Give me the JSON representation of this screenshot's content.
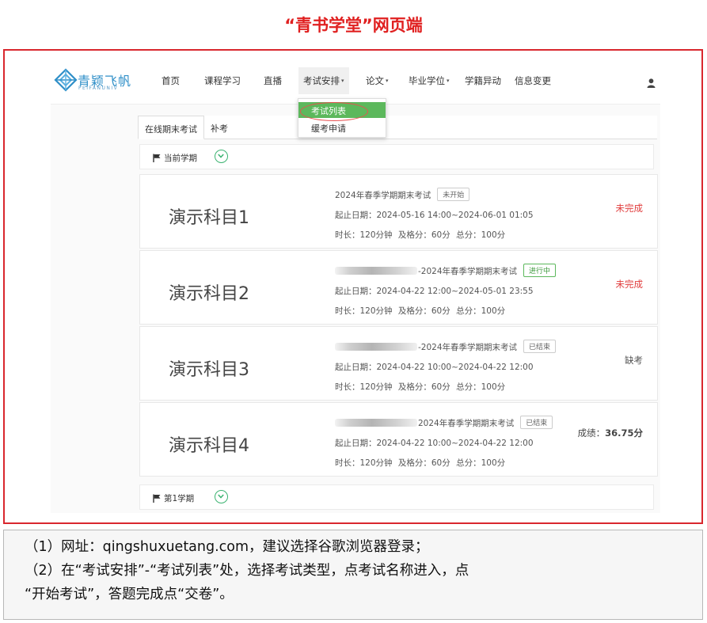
{
  "heading": "“青书学堂”网页端",
  "nav": {
    "logo_cn": "青颖飞帆",
    "logo_en": "FEIFANUNIV",
    "items": [
      {
        "label": "首页"
      },
      {
        "label": "课程学习"
      },
      {
        "label": "直播"
      },
      {
        "label": "考试安排"
      },
      {
        "label": "论文"
      },
      {
        "label": "毕业学位"
      },
      {
        "label": "学籍异动"
      },
      {
        "label": "信息变更"
      }
    ],
    "caret": "▾"
  },
  "dropdown": {
    "items": [
      {
        "label": "考试列表"
      },
      {
        "label": "缓考申请"
      }
    ]
  },
  "tabs": [
    {
      "label": "在线期末考试"
    },
    {
      "label": "补考"
    }
  ],
  "semesters": [
    {
      "label": "当前学期"
    },
    {
      "label": "第1学期"
    }
  ],
  "exams": [
    {
      "subject": "演示科目1",
      "title": "2024年春季学期期末考试",
      "status": "未开始",
      "date": "起止日期：2024-05-16 14:00~2024-06-01 01:05",
      "meta": "时长：120分钟  及格分：60分  总分：100分",
      "result": "未完成"
    },
    {
      "subject": "演示科目2",
      "title": "-2024年春季学期期末考试",
      "status": "进行中",
      "date": "起止日期：2024-04-22 12:00~2024-05-01 23:55",
      "meta": "时长：120分钟  及格分：60分  总分：100分",
      "result": "未完成"
    },
    {
      "subject": "演示科目3",
      "title": "-2024年春季学期期末考试",
      "status": "已结束",
      "date": "起止日期：2024-04-22 10:00~2024-04-22 12:00",
      "meta": "时长：120分钟  及格分：60分  总分：100分",
      "result": "缺考"
    },
    {
      "subject": "演示科目4",
      "title": "2024年春季学期期末考试",
      "status": "已结束",
      "date": "起止日期：2024-04-22 10:00~2024-04-22 12:00",
      "meta": "时长：120分钟  及格分：60分  总分：100分",
      "result_label": "成绩：",
      "result_value": "36.75分"
    }
  ],
  "instructions": {
    "line1": "（1）网址：qingshuxuetang.com，建议选择谷歌浏览器登录；",
    "line2": "（2）在“考试安排”-“考试列表”处，选择考试类型，点考试名称进入，点",
    "line3": "“开始考试”，答题完成点“交卷”。"
  },
  "colors": {
    "heading_red": "#e02020",
    "frame_red": "#d9272e",
    "dropdown_green": "#5cb85c",
    "incomplete_red": "#e03a3a",
    "logo_blue": "#2f8fc8"
  },
  "icons": [
    "logo-icon",
    "user-icon",
    "flag-icon",
    "chevron-down-icon"
  ]
}
